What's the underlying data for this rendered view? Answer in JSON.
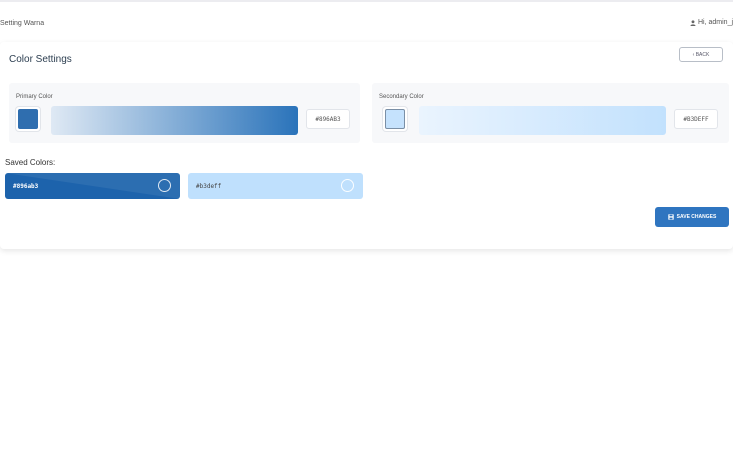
{
  "header": {
    "brand": "Setting Warna",
    "user_greeting": "Hi, admin_j"
  },
  "page": {
    "title": "Color Settings",
    "back_label": "‹ BACK"
  },
  "primary": {
    "label": "Primary Color",
    "hex": "#896AB3",
    "swatch_color": "#2f6eaf",
    "gradient_start": "#dfe9f4",
    "gradient_end": "#2a73ba"
  },
  "secondary": {
    "label": "Secondary Color",
    "hex": "#B3DEFF",
    "swatch_color": "#c5e2fd",
    "gradient_start": "#eaf4fe",
    "gradient_end": "#c2e1fd"
  },
  "saved": {
    "label": "Saved Colors:",
    "items": [
      {
        "hex": "#896ab3",
        "bg": "#1d63ac",
        "text_color": "#ffffff"
      },
      {
        "hex": "#b3deff",
        "bg": "#bfe0fd",
        "text_color": "#444444"
      }
    ]
  },
  "actions": {
    "save_label": "SAVE CHANGES"
  }
}
